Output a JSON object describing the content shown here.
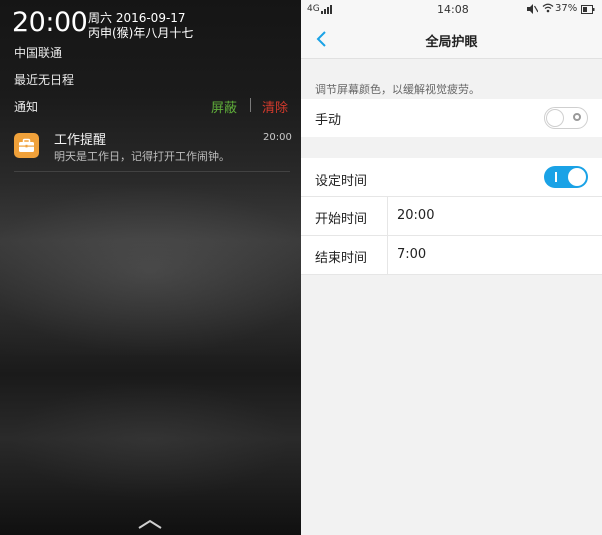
{
  "shade": {
    "time": "20:00",
    "date_line1": "周六 2016-09-17",
    "date_line2": "丙申(猴)年八月十七",
    "carrier": "中国联通",
    "schedule": "最近无日程",
    "notifications_label": "通知",
    "mask_button": "屏蔽",
    "clear_button": "清除",
    "notification": {
      "app_icon": "briefcase-icon",
      "title": "工作提醒",
      "time": "20:00",
      "body": "明天是工作日，记得打开工作闹钟。"
    },
    "handle_icon": "chevron-up-icon"
  },
  "settings": {
    "status": {
      "network": "4G",
      "clock": "14:08",
      "battery": "37%"
    },
    "title": "全局护眼",
    "description": "调节屏幕颜色，以缓解视觉疲劳。",
    "manual": {
      "label": "手动",
      "enabled": false
    },
    "schedule": {
      "label": "设定时间",
      "enabled": true
    },
    "start": {
      "label": "开始时间",
      "value": "20:00"
    },
    "end": {
      "label": "结束时间",
      "value": "7:00"
    },
    "colors": {
      "accent": "#1aa2e6",
      "mask": "#5fae3a",
      "clear": "#d23a2c",
      "app_icon": "#f0a13a"
    }
  }
}
